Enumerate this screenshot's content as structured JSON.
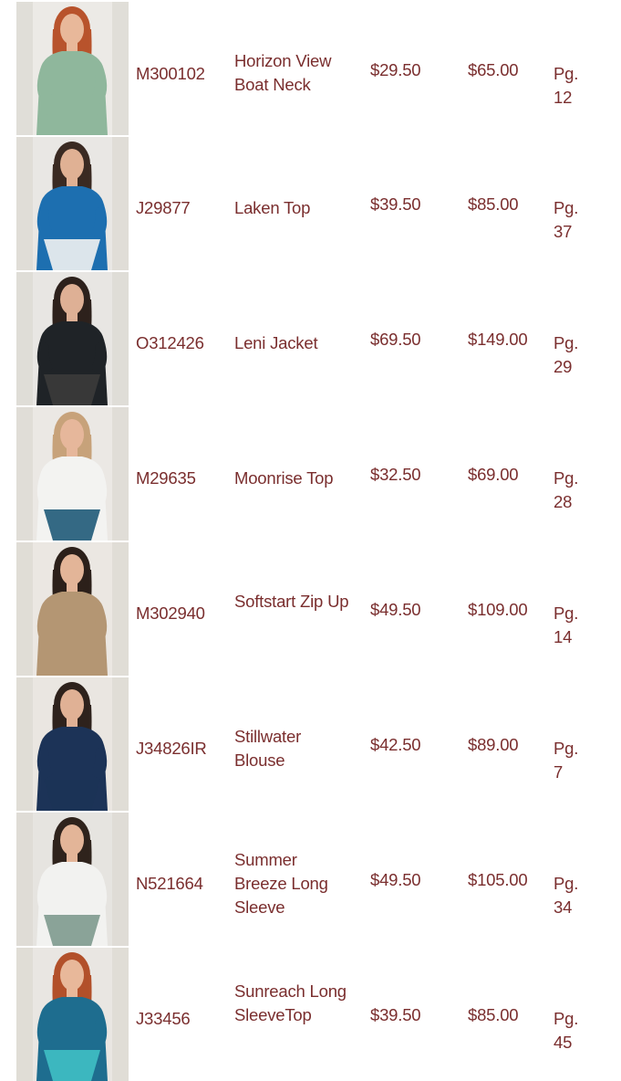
{
  "products": [
    {
      "sku": "M300102",
      "name": "Horizon View Boat Neck",
      "cost": "$29.50",
      "msrp": "$65.00",
      "page": "Pg. 12",
      "photo": {
        "bg": "#eceae6",
        "garment": "#8fb79c",
        "hair": "#b8532c",
        "skin": "#e8b89a",
        "bottom": "#8fb79c"
      }
    },
    {
      "sku": "J29877",
      "name": "Laken Top",
      "cost": "$39.50",
      "msrp": "$85.00",
      "page": "Pg. 37",
      "photo": {
        "bg": "#e9e7e4",
        "garment": "#1d6fb0",
        "hair": "#3a2a22",
        "skin": "#e0b194",
        "bottom": "#f2f2f2"
      }
    },
    {
      "sku": "O312426",
      "name": "Leni Jacket",
      "cost": "$69.50",
      "msrp": "$149.00",
      "page": "Pg. 29",
      "photo": {
        "bg": "#e8e6e3",
        "garment": "#1f2327",
        "hair": "#2d211c",
        "skin": "#deb095",
        "bottom": "#3b3b3b"
      }
    },
    {
      "sku": "M29635",
      "name": "Moonrise Top",
      "cost": "$32.50",
      "msrp": "$69.00",
      "page": "Pg. 28",
      "photo": {
        "bg": "#ebe8e4",
        "garment": "#f3f3f1",
        "hair": "#c7a27a",
        "skin": "#e6b79b",
        "bottom": "#1f5a78"
      }
    },
    {
      "sku": "M302940",
      "name": "Softstart Zip Up",
      "cost": "$49.50",
      "msrp": "$109.00",
      "page": "Pg. 14",
      "photo": {
        "bg": "#ebe7e2",
        "garment": "#b49673",
        "hair": "#2c201a",
        "skin": "#e3b598",
        "bottom": "#b49673"
      }
    },
    {
      "sku": "J34826IR",
      "name": "Stillwater Blouse",
      "cost": "$42.50",
      "msrp": "$89.00",
      "page": "Pg. 7",
      "photo": {
        "bg": "#eae6e1",
        "garment": "#1c3357",
        "hair": "#2e221c",
        "skin": "#e0b195",
        "bottom": "#1c3357"
      }
    },
    {
      "sku": "N521664",
      "name": "Summer Breeze Long Sleeve",
      "cost": "$49.50",
      "msrp": "$105.00",
      "page": "Pg. 34",
      "photo": {
        "bg": "#e6e4e0",
        "garment": "#f2f2f0",
        "hair": "#2f231c",
        "skin": "#e3b598",
        "bottom": "#7e9a8e"
      }
    },
    {
      "sku": "J33456",
      "name": "Sunreach Long SleeveTop",
      "cost": "$39.50",
      "msrp": "$85.00",
      "page": "Pg. 45",
      "photo": {
        "bg": "#e9e6e2",
        "garment": "#1e6d8f",
        "hair": "#b2502a",
        "skin": "#e8b89a",
        "bottom": "#3fbfc4"
      }
    }
  ]
}
